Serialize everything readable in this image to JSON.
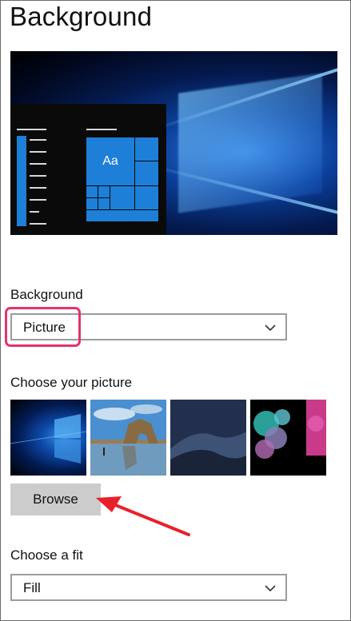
{
  "page": {
    "title": "Background"
  },
  "background_section": {
    "label": "Background",
    "selected": "Picture"
  },
  "picture_section": {
    "label": "Choose your picture",
    "thumbnails": [
      {
        "name": "windows-10-hero"
      },
      {
        "name": "beach-rock-arch"
      },
      {
        "name": "desert-dunes-night"
      },
      {
        "name": "colorful-ink-clouds"
      }
    ],
    "browse_label": "Browse"
  },
  "fit_section": {
    "label": "Choose a fit",
    "selected": "Fill"
  },
  "preview": {
    "tile_label": "Aa"
  },
  "colors": {
    "accent": "#1e7fd8",
    "highlight": "#e5336b",
    "arrow": "#e8202a",
    "button_bg": "#cccccc"
  }
}
